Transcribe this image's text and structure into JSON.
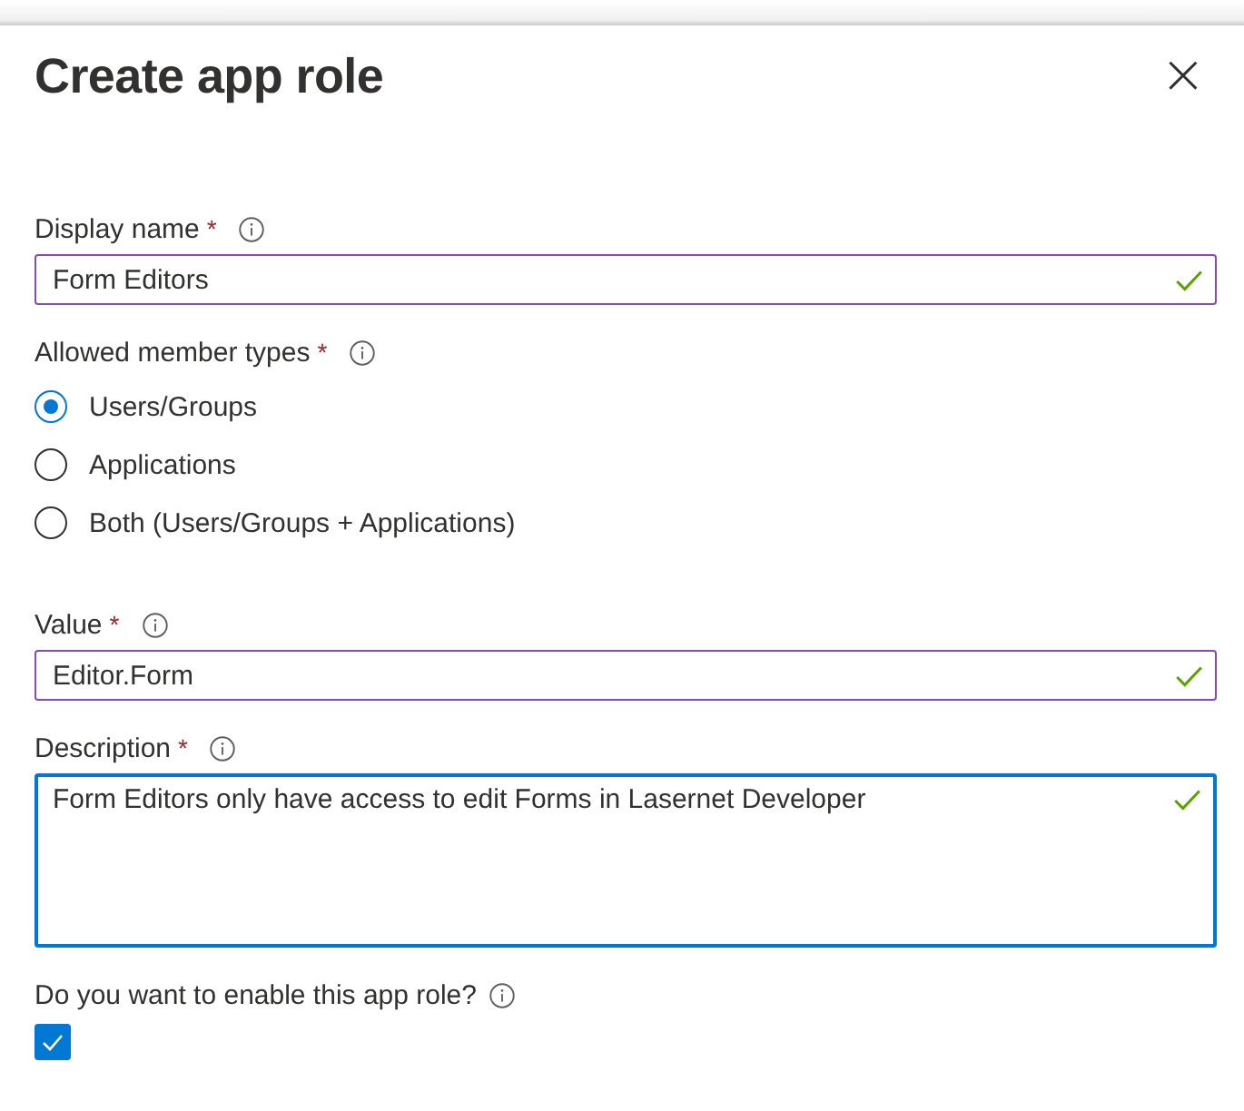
{
  "panel": {
    "title": "Create app role",
    "close_glyph": "×"
  },
  "display_name": {
    "label": "Display name",
    "required_mark": "*",
    "value": "Form Editors",
    "valid": true,
    "focused": false,
    "multiline": false
  },
  "member_types": {
    "label": "Allowed member types",
    "required_mark": "*",
    "options": [
      {
        "label": "Users/Groups",
        "selected": true
      },
      {
        "label": "Applications",
        "selected": false
      },
      {
        "label": "Both (Users/Groups + Applications)",
        "selected": false
      }
    ]
  },
  "value": {
    "label": "Value",
    "required_mark": "*",
    "value": "Editor.Form",
    "valid": true,
    "focused": false,
    "multiline": false
  },
  "description": {
    "label": "Description",
    "required_mark": "*",
    "value": "Form Editors only have access to edit Forms in Lasernet Developer",
    "valid": true,
    "focused": true,
    "multiline": true
  },
  "enable": {
    "label": "Do you want to enable this app role?",
    "checked": true
  }
}
